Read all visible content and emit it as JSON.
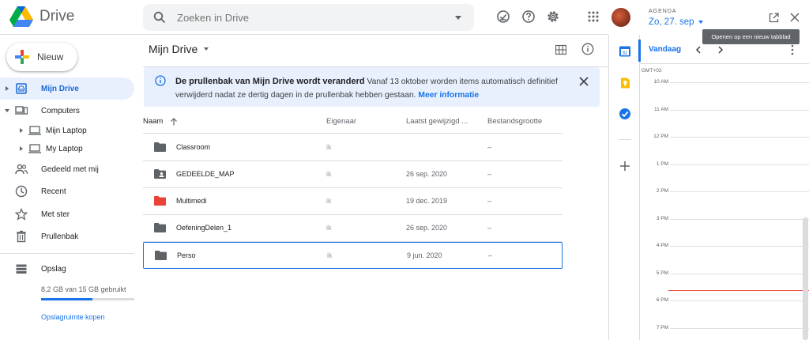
{
  "app": {
    "name": "Drive"
  },
  "search": {
    "placeholder": "Zoeken in Drive"
  },
  "new_button": "Nieuw",
  "sidebar": {
    "items": [
      {
        "label": "Mijn Drive"
      },
      {
        "label": "Computers"
      },
      {
        "label": "Mijn Laptop"
      },
      {
        "label": "My Laptop"
      },
      {
        "label": "Gedeeld met mij"
      },
      {
        "label": "Recent"
      },
      {
        "label": "Met ster"
      },
      {
        "label": "Prullenbak"
      },
      {
        "label": "Opslag"
      }
    ],
    "storage_text": "8,2 GB van 15 GB gebruikt",
    "storage_used_fraction": 0.55,
    "buy_storage": "Opslagruimte kopen"
  },
  "main": {
    "breadcrumb": "Mijn Drive",
    "banner": {
      "title": "De prullenbak van Mijn Drive wordt veranderd",
      "text": " Vanaf 13 oktober worden items automatisch definitief verwijderd nadat ze dertig dagen in de prullenbak hebben gestaan. ",
      "link": "Meer informatie"
    },
    "columns": {
      "name": "Naam",
      "owner": "Eigenaar",
      "modified": "Laatst gewijzigd ...",
      "size": "Bestandsgrootte"
    },
    "files": [
      {
        "name": "Classroom",
        "owner": "ik",
        "modified": "",
        "size": "–",
        "icon": "folder-icon"
      },
      {
        "name": "GEDEELDE_MAP",
        "owner": "ik",
        "modified": "26 sep. 2020",
        "size": "–",
        "icon": "shared-folder-icon"
      },
      {
        "name": "Multimedi",
        "owner": "ik",
        "modified": "19 dec. 2019",
        "size": "–",
        "icon": "folder-red-icon"
      },
      {
        "name": "OefeningDelen_1",
        "owner": "ik",
        "modified": "26 sep. 2020",
        "size": "–",
        "icon": "folder-icon"
      },
      {
        "name": "Perso",
        "owner": "ik",
        "modified": "9 jun. 2020",
        "size": "–",
        "icon": "folder-icon"
      }
    ]
  },
  "agenda": {
    "label": "AGENDA",
    "date": "Zo, 27. sep",
    "tooltip": "Openen op een nieuw tabblad",
    "today": "Vandaag",
    "timezone": "GMT+02",
    "hours": [
      "10 AM",
      "11 AM",
      "12 PM",
      "1 PM",
      "2 PM",
      "3 PM",
      "4 PM",
      "5 PM",
      "6 PM",
      "7 PM"
    ]
  },
  "colors": {
    "accent": "#1a73e8",
    "active_bg": "#e8f0fe",
    "now_line": "#ea4335"
  }
}
